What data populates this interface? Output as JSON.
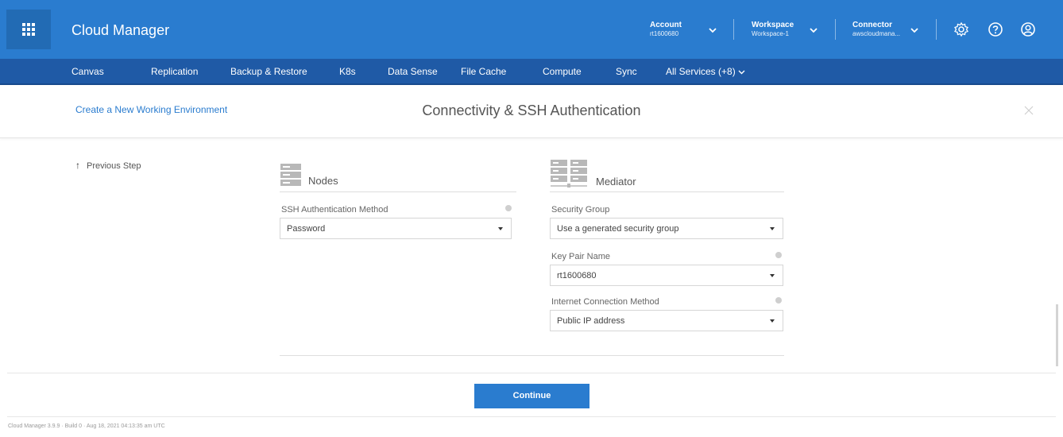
{
  "header": {
    "app_title": "Cloud Manager",
    "account_label": "Account",
    "account_value": "rt1600680",
    "workspace_label": "Workspace",
    "workspace_value": "Workspace-1",
    "connector_label": "Connector",
    "connector_value": "awscloudmana...",
    "icons": [
      "apps-grid-icon",
      "settings-gear-icon",
      "help-icon",
      "user-profile-icon"
    ],
    "brand_color": "#2a7ccf",
    "nav_color": "#1f5aa6"
  },
  "nav": {
    "items": [
      "Canvas",
      "Replication",
      "Backup & Restore",
      "K8s",
      "Data Sense",
      "File Cache",
      "Compute",
      "Sync",
      "All Services (+8)"
    ]
  },
  "subheader": {
    "create_link": "Create a New Working Environment",
    "title": "Connectivity & SSH Authentication"
  },
  "body": {
    "previous_step": "Previous Step",
    "nodes": {
      "title": "Nodes",
      "ssh_label": "SSH Authentication Method",
      "ssh_value": "Password"
    },
    "mediator": {
      "title": "Mediator",
      "security_group_label": "Security Group",
      "security_group_value": "Use a generated security group",
      "key_pair_label": "Key Pair Name",
      "key_pair_value": "rt1600680",
      "internet_label": "Internet Connection Method",
      "internet_value": "Public IP address"
    }
  },
  "footer": {
    "continue_label": "Continue",
    "build_info": "Cloud Manager 3.9.9 · Build 0 · Aug 18, 2021 04:13:35 am UTC"
  }
}
